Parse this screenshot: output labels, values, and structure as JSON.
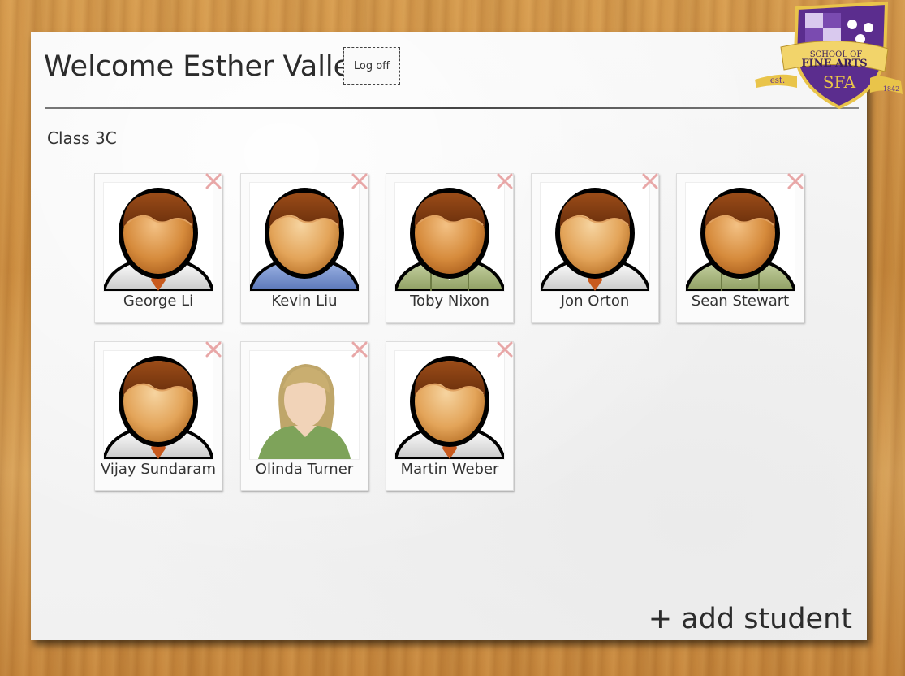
{
  "header": {
    "welcome": "Welcome Esther Valle!",
    "logoff_label": "Log off"
  },
  "crest": {
    "line1": "SCHOOL OF",
    "line2": "FINE ARTS",
    "monogram": "SFA",
    "est": "est.",
    "year": "1842"
  },
  "class_name": "Class 3C",
  "students": [
    {
      "name": "George Li",
      "avatar": "male-shirt-tie-icon"
    },
    {
      "name": "Kevin Liu",
      "avatar": "male-sweater-icon"
    },
    {
      "name": "Toby Nixon",
      "avatar": "male-green-shirt-icon"
    },
    {
      "name": "Jon Orton",
      "avatar": "male-shirt-tie-icon"
    },
    {
      "name": "Sean Stewart",
      "avatar": "male-green-shirt-icon"
    },
    {
      "name": "Vijay Sundaram",
      "avatar": "male-shirt-tie-icon"
    },
    {
      "name": "Olinda Turner",
      "avatar": "female-photo-icon"
    },
    {
      "name": "Martin Weber",
      "avatar": "male-shirt-tie-icon"
    }
  ],
  "add_student_label": "+ add student",
  "colors": {
    "accent_purple": "#5b2d8e",
    "ribbon_gold": "#e9c44a",
    "remove_x": "#e8a7a7"
  }
}
